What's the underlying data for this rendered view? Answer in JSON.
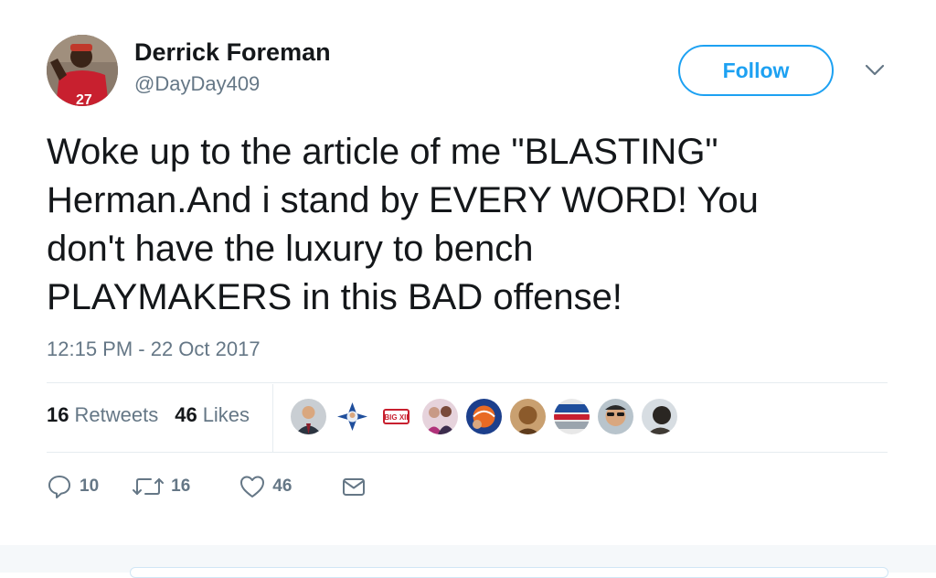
{
  "tweet": {
    "author": {
      "name": "Derrick Foreman",
      "handle": "@DayDay409",
      "avatar_icon": "user-avatar-red-jersey"
    },
    "follow_label": "Follow",
    "text": "Woke up to the article of me \"BLASTING\"\nHerman.And i stand by EVERY WORD! You\ndon't have the luxury to bench\nPLAYMAKERS in this BAD offense!",
    "timestamp": "12:15 PM - 22 Oct 2017",
    "stats": {
      "retweets_count": "16",
      "retweets_label": "Retweets",
      "likes_count": "46",
      "likes_label": "Likes"
    },
    "likers": [
      "liker-avatar-suit",
      "liker-avatar-team-logo",
      "liker-avatar-big-xii",
      "liker-avatar-couple",
      "liker-avatar-mets",
      "liker-avatar-portrait",
      "liker-avatar-badge",
      "liker-avatar-sunglasses",
      "liker-avatar-silhouette"
    ],
    "liker_logo_text": "BIG XII",
    "actions": {
      "reply_count": "10",
      "retweet_count": "16",
      "like_count": "46"
    }
  },
  "colors": {
    "accent": "#1da1f2",
    "text": "#14171a",
    "muted": "#657786",
    "divider": "#e6ecf0"
  }
}
